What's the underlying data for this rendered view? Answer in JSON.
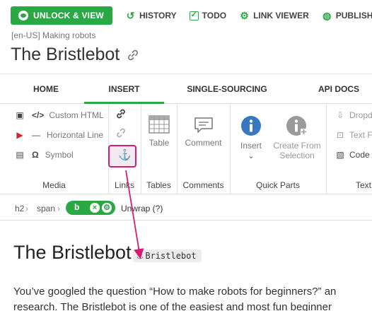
{
  "toolbar": {
    "unlock_view": "UNLOCK & VIEW",
    "history": "HISTORY",
    "todo": "TODO",
    "link_viewer": "LINK VIEWER",
    "publish": "PUBLISH"
  },
  "breadcrumb": "[en-US] Making robots",
  "page_title": "The Bristlebot",
  "tabs": [
    "HOME",
    "INSERT",
    "SINGLE-SOURCING",
    "API DOCS"
  ],
  "active_tab": "INSERT",
  "ribbon": {
    "media": {
      "label": "Media",
      "items": [
        "Custom HTML",
        "Horizontal Line",
        "Symbol"
      ]
    },
    "links": {
      "label": "Links"
    },
    "tables": {
      "label": "Tables",
      "table_btn": "Table"
    },
    "comments": {
      "label": "Comments",
      "comment_btn": "Comment"
    },
    "quick_parts": {
      "label": "Quick Parts",
      "insert_btn": "Insert",
      "create_line1": "Create From",
      "create_line2": "Selection"
    },
    "text": {
      "label": "Text",
      "items": [
        "Dropd",
        "Text Fo",
        "Code S"
      ]
    }
  },
  "element_path": {
    "items": [
      "h2",
      "span"
    ],
    "selected": "b",
    "unwrap": "Unwrap (?)"
  },
  "content": {
    "heading": "The Bristlebot",
    "anchor_chip": "Bristlebot",
    "para_line1": "You’ve googled the question “How to make robots for beginners?” an",
    "para_line2": "research. The Bristlebot is one of the easiest and most fun beginner"
  },
  "colors": {
    "accent": "#2aa844",
    "annotation": "#d81b72"
  }
}
